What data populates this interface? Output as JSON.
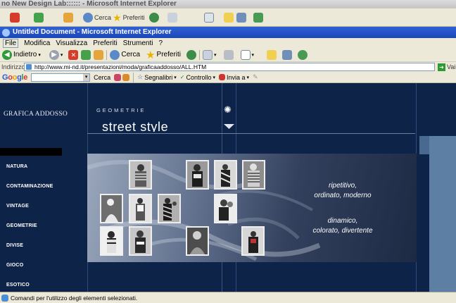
{
  "background_window": {
    "title": "no New Design Lab:::::: - Microsoft Internet Explorer",
    "search_label": "Cerca",
    "favorites_label": "Preferiti"
  },
  "window": {
    "title": "Untitled Document - Microsoft Internet Explorer"
  },
  "menu": [
    "File",
    "Modifica",
    "Visualizza",
    "Preferiti",
    "Strumenti",
    "?"
  ],
  "toolbar": {
    "back_label": "Indietro",
    "search_label": "Cerca",
    "favorites_label": "Preferiti"
  },
  "address": {
    "label": "Indirizzo",
    "url": "http://www.mi-nd.it/presentazioni/moda/graficaaddosso/ALL.HTM",
    "go_label": "Vai"
  },
  "google_toolbar": {
    "logo": [
      "G",
      "o",
      "o",
      "g",
      "l",
      "e"
    ],
    "search_label": "Cerca",
    "bookmarks_label": "Segnalibri",
    "check_label": "Controllo",
    "send_label": "Invia a"
  },
  "page": {
    "brand": "GRAFICA ADDOSSO",
    "nav": [
      "NATURA",
      "CONTAMINAZIONE",
      "VINTAGE",
      "GEOMETRIE",
      "DIVISE",
      "GIOCO",
      "ESOTICO"
    ],
    "section_label": "GEOMETRIE",
    "headline": "street style",
    "caption1": [
      "ripetitivo,",
      "ordinato, moderno"
    ],
    "caption2": [
      "dinamico,",
      "colorato, divertente"
    ]
  },
  "status": {
    "text": "Comandi per l'utilizzo degli elementi selezionati."
  },
  "colors": {
    "page_bg": "#0e2348",
    "title_bar": "#1c46b6",
    "chrome": "#ece9d8",
    "side_panel": "#5d7fa4"
  }
}
